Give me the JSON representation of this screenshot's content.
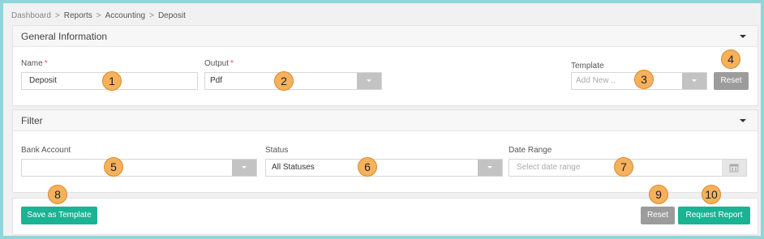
{
  "breadcrumb": [
    "Dashboard",
    "Reports",
    "Accounting",
    "Deposit"
  ],
  "breadcrumb_sep": ">",
  "general": {
    "title": "General Information",
    "name_label": "Name",
    "name_value": "Deposit",
    "output_label": "Output",
    "output_value": "Pdf",
    "template_label": "Template",
    "template_placeholder": "Add New ..",
    "reset_label": "Reset",
    "required_mark": "*"
  },
  "filter": {
    "title": "Filter",
    "bank_label": "Bank Account",
    "bank_value": "",
    "status_label": "Status",
    "status_value": "All Statuses",
    "date_label": "Date Range",
    "date_placeholder": "Select date range"
  },
  "footer": {
    "save_template_label": "Save as Template",
    "reset_label": "Reset",
    "request_label": "Request Report"
  },
  "callouts": [
    "1",
    "2",
    "3",
    "4",
    "5",
    "6",
    "7",
    "8",
    "9",
    "10"
  ],
  "colors": {
    "teal": "#1ab394",
    "grey_button": "#9c9c9c",
    "callout": "#f6b15c",
    "required": "#d9534f",
    "outer_border": "#8fd6da"
  }
}
